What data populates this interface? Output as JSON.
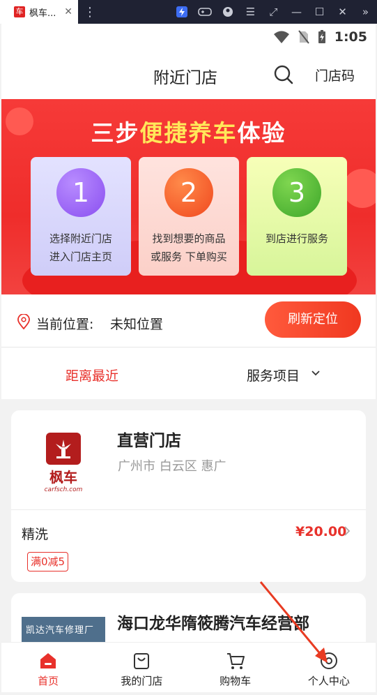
{
  "browser": {
    "tab_title": "枫车...",
    "tab_close": "✕",
    "favicon_text": "车"
  },
  "status": {
    "time": "1:05"
  },
  "header": {
    "title": "附近门店",
    "store_code": "门店码"
  },
  "banner": {
    "title_part1": "三步",
    "title_highlight": "便捷养车",
    "title_part2": "体验",
    "steps": [
      {
        "num": "1",
        "line1": "选择附近门店",
        "line2": "进入门店主页"
      },
      {
        "num": "2",
        "line1": "找到想要的商品",
        "line2": "或服务 下单购买"
      },
      {
        "num": "3",
        "line1": "到店进行服务",
        "line2": ""
      }
    ]
  },
  "location": {
    "label": "当前位置:",
    "value": "未知位置",
    "refresh": "刷新定位"
  },
  "filters": {
    "nearest": "距离最近",
    "service": "服务项目"
  },
  "stores": [
    {
      "name": "直营门店",
      "address": "广州市 白云区 惠广",
      "logo_text": "枫车",
      "logo_sub": "carfsch.com",
      "service": "精洗",
      "price": "¥20.00",
      "coupon": "满0减5"
    },
    {
      "name": "海口龙华隋筱腾汽车经营部",
      "image_text": "凯达汽车修理厂"
    }
  ],
  "tabbar": [
    {
      "label": "首页",
      "icon": "home-icon"
    },
    {
      "label": "我的门店",
      "icon": "bag-icon"
    },
    {
      "label": "购物车",
      "icon": "cart-icon"
    },
    {
      "label": "个人中心",
      "icon": "user-icon"
    }
  ],
  "colors": {
    "accent": "#e8312b",
    "banner": "#f63a38",
    "highlight": "#ffe85a"
  }
}
